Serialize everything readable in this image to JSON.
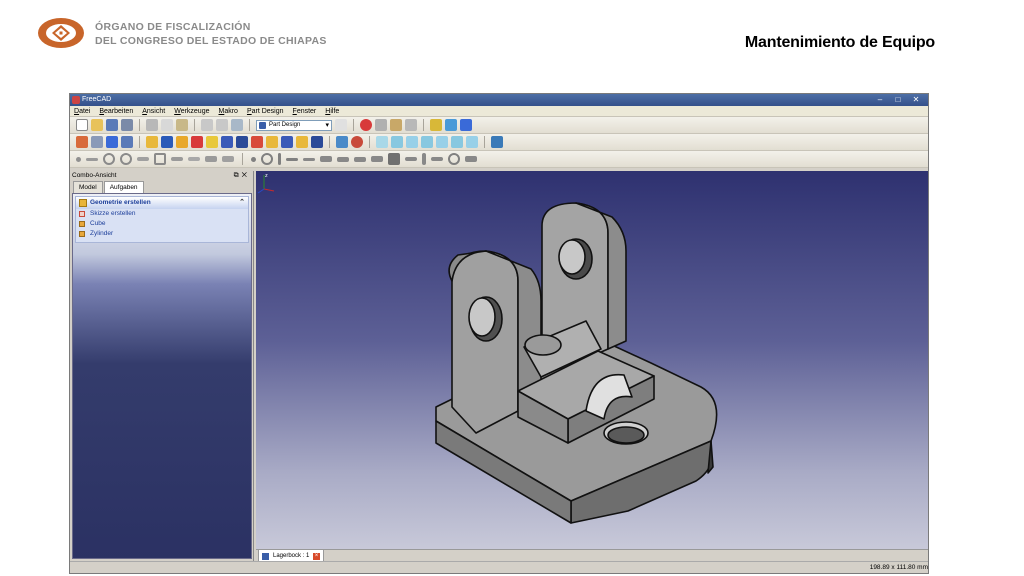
{
  "header": {
    "org_line1": "ÓRGANO DE FISCALIZACIÓN",
    "org_line2": "DEL CONGRESO DEL ESTADO DE CHIAPAS",
    "slide_title": "Mantenimiento de Equipo",
    "logo_color": "#c8652a"
  },
  "window": {
    "title": "FreeCAD",
    "minimize_icon": "minimize-icon",
    "maximize_icon": "maximize-icon",
    "close_icon": "close-icon"
  },
  "menu": [
    "Datei",
    "Bearbeiten",
    "Ansicht",
    "Werkzeuge",
    "Makro",
    "Part Design",
    "Fenster",
    "Hilfe"
  ],
  "toolbar": {
    "workbench_selected": "Part Design"
  },
  "combo": {
    "title": "Combo-Ansicht",
    "tabs": [
      "Model",
      "Aufgaben"
    ],
    "active_tab": "Aufgaben",
    "panel_title": "Geometrie erstellen",
    "items": [
      "Skizze erstellen",
      "Cube",
      "Zylinder"
    ]
  },
  "document_tab": {
    "label": "Lagerbock : 1"
  },
  "status": {
    "dimensions": "198.89 x 111.80 mm"
  },
  "colors": {
    "view_top": "#2e3170",
    "view_bottom": "#c8c9d9",
    "part_gray": "#8c8c8c",
    "task_text": "#1c3e9a"
  }
}
